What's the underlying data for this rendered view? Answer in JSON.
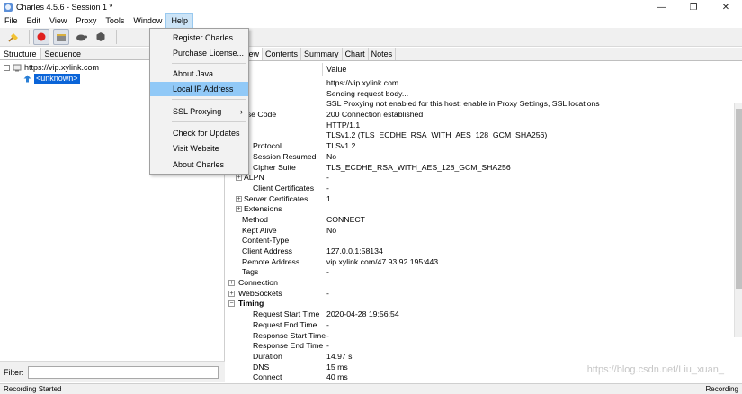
{
  "window": {
    "title": "Charles 4.5.6 - Session 1 *",
    "minimize": "—",
    "maximize": "❐",
    "close": "✕"
  },
  "menubar": [
    "File",
    "Edit",
    "View",
    "Proxy",
    "Tools",
    "Window",
    "Help"
  ],
  "help_menu": {
    "items": [
      "Register Charles...",
      "Purchase License...",
      "About Java",
      "Local IP Address",
      "SSL Proxying",
      "Check for Updates",
      "Visit Website",
      "About Charles"
    ],
    "highlighted": "Local IP Address",
    "submenu_arrow": "›"
  },
  "left": {
    "tabs": [
      "Structure",
      "Sequence"
    ],
    "tree": {
      "host": "https://vip.xylink.com",
      "child": "<unknown>",
      "toggle": "−"
    },
    "filter_label": "Filter:"
  },
  "right": {
    "tabs": [
      "view",
      "Contents",
      "Summary",
      "Chart",
      "Notes"
    ],
    "header_name": "e",
    "header_value": "Value",
    "rows": [
      {
        "name": "L",
        "value": "https://vip.xylink.com"
      },
      {
        "name": "tus",
        "value": "Sending request body..."
      },
      {
        "name": "tes",
        "value": "SSL Proxying not enabled for this host: enable in Proxy Settings, SSL locations"
      },
      {
        "name": "sponse Code",
        "value": "200 Connection established"
      },
      {
        "name": "tocol",
        "value": "HTTP/1.1"
      },
      {
        "name": "S",
        "value": "TLSv1.2 (TLS_ECDHE_RSA_WITH_AES_128_GCM_SHA256)"
      },
      {
        "name": "Protocol",
        "value": "TLSv1.2"
      },
      {
        "name": "Session Resumed",
        "value": "No"
      },
      {
        "name": "Cipher Suite",
        "value": "TLS_ECDHE_RSA_WITH_AES_128_GCM_SHA256"
      },
      {
        "name": "ALPN",
        "value": "-",
        "toggle": "+"
      },
      {
        "name": "Client Certificates",
        "value": "-"
      },
      {
        "name": "Server Certificates",
        "value": "1",
        "toggle": "+"
      },
      {
        "name": "Extensions",
        "value": "",
        "toggle": "+"
      },
      {
        "name": "Method",
        "value": "CONNECT"
      },
      {
        "name": "Kept Alive",
        "value": "No"
      },
      {
        "name": "Content-Type",
        "value": ""
      },
      {
        "name": "Client Address",
        "value": "127.0.0.1:58134"
      },
      {
        "name": "Remote Address",
        "value": "vip.xylink.com/47.93.92.195:443"
      },
      {
        "name": "Tags",
        "value": "-"
      },
      {
        "name": "Connection",
        "value": "",
        "toggle": "+"
      },
      {
        "name": "WebSockets",
        "value": "-",
        "toggle": "+"
      },
      {
        "name": "Timing",
        "value": "",
        "toggle": "−",
        "bold": true
      },
      {
        "name": "Request Start Time",
        "value": "2020-04-28 19:56:54"
      },
      {
        "name": "Request End Time",
        "value": "-"
      },
      {
        "name": "Response Start Time",
        "value": "-"
      },
      {
        "name": "Response End Time",
        "value": "-"
      },
      {
        "name": "Duration",
        "value": "14.97 s"
      },
      {
        "name": "DNS",
        "value": "15 ms"
      },
      {
        "name": "Connect",
        "value": "40 ms"
      }
    ]
  },
  "status": {
    "left": "Recording Started",
    "right": "Recording"
  },
  "watermark": "https://blog.csdn.net/Liu_xuan_"
}
